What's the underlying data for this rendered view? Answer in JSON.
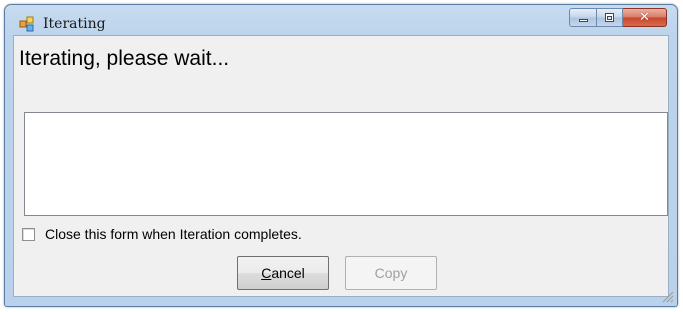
{
  "window": {
    "title": "Iterating",
    "icon": "app-form-icon",
    "caption_buttons": [
      "minimize-icon",
      "maximize-icon",
      "close-icon"
    ]
  },
  "main": {
    "heading": "Iterating, please wait...",
    "output_text": ""
  },
  "options": {
    "close_on_complete_label": "Close this form when Iteration completes.",
    "close_on_complete_checked": false
  },
  "buttons": {
    "cancel_mnemonic": "C",
    "cancel_rest": "ancel",
    "copy_label": "Copy",
    "copy_enabled": false
  },
  "colors": {
    "title_bar": "#bcd3eb",
    "close_button": "#c8452c",
    "client_background": "#f0f0f0"
  }
}
